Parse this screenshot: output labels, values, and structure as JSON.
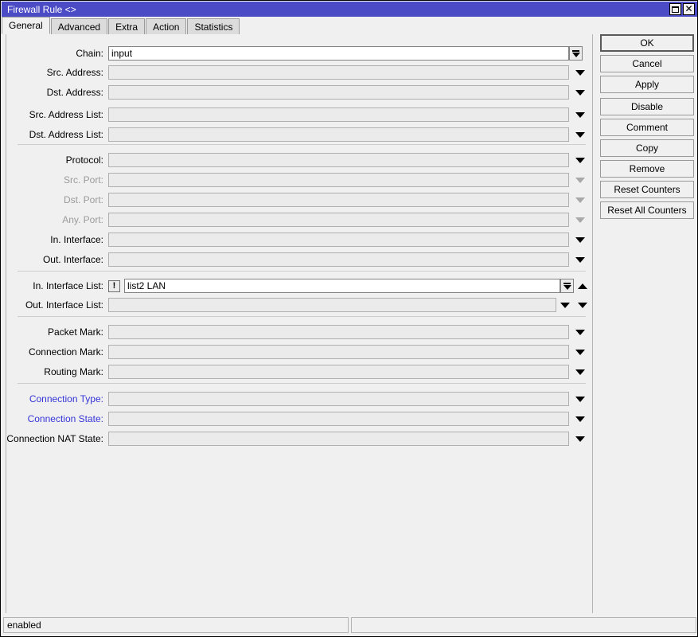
{
  "window": {
    "title": "Firewall Rule <>",
    "maximize_label": "maximize",
    "close_label": "close"
  },
  "tabs": [
    {
      "label": "General",
      "active": true
    },
    {
      "label": "Advanced",
      "active": false
    },
    {
      "label": "Extra",
      "active": false
    },
    {
      "label": "Action",
      "active": false
    },
    {
      "label": "Statistics",
      "active": false
    }
  ],
  "fields": [
    {
      "label": "Chain:",
      "value": "input",
      "state": "editable",
      "control": "combo"
    },
    {
      "label": "Src. Address:",
      "value": "",
      "state": "normal",
      "control": "arrow"
    },
    {
      "label": "Dst. Address:",
      "value": "",
      "state": "normal",
      "control": "arrow"
    },
    {
      "label": "Src. Address List:",
      "value": "",
      "state": "normal",
      "control": "arrow"
    },
    {
      "label": "Dst. Address List:",
      "value": "",
      "state": "normal",
      "control": "arrow"
    },
    {
      "label": "Protocol:",
      "value": "",
      "state": "normal",
      "control": "arrow"
    },
    {
      "label": "Src. Port:",
      "value": "",
      "state": "disabled",
      "control": "arrow"
    },
    {
      "label": "Dst. Port:",
      "value": "",
      "state": "disabled",
      "control": "arrow"
    },
    {
      "label": "Any. Port:",
      "value": "",
      "state": "disabled",
      "control": "arrow"
    },
    {
      "label": "In. Interface:",
      "value": "",
      "state": "normal",
      "control": "arrow"
    },
    {
      "label": "Out. Interface:",
      "value": "",
      "state": "normal",
      "control": "arrow"
    },
    {
      "label": "In. Interface List:",
      "value": "list2 LAN",
      "state": "editable",
      "control": "combo-negate-spin",
      "negate": "!"
    },
    {
      "label": "Out. Interface List:",
      "value": "",
      "state": "normal",
      "control": "arrow-spin-down"
    },
    {
      "label": "Packet Mark:",
      "value": "",
      "state": "normal",
      "control": "arrow"
    },
    {
      "label": "Connection Mark:",
      "value": "",
      "state": "normal",
      "control": "arrow"
    },
    {
      "label": "Routing Mark:",
      "value": "",
      "state": "normal",
      "control": "arrow"
    },
    {
      "label": "Connection Type:",
      "value": "",
      "state": "link",
      "control": "arrow"
    },
    {
      "label": "Connection State:",
      "value": "",
      "state": "link",
      "control": "arrow"
    },
    {
      "label": "Connection NAT State:",
      "value": "",
      "state": "normal",
      "control": "arrow"
    }
  ],
  "buttons": [
    {
      "label": "OK",
      "variant": "default"
    },
    {
      "label": "Cancel",
      "variant": "normal"
    },
    {
      "label": "Apply",
      "variant": "normal"
    },
    {
      "label": "Disable",
      "variant": "gap"
    },
    {
      "label": "Comment",
      "variant": "normal"
    },
    {
      "label": "Copy",
      "variant": "normal"
    },
    {
      "label": "Remove",
      "variant": "normal"
    },
    {
      "label": "Reset Counters",
      "variant": "normal"
    },
    {
      "label": "Reset All Counters",
      "variant": "normal"
    }
  ],
  "statusbar": {
    "left": "enabled",
    "right": ""
  },
  "colors": {
    "titlebar": "#4b4bc6",
    "titlebar_text": "#ffffff",
    "window_bg": "#f0f0f0",
    "field_bg": "#ebebeb",
    "field_editable_bg": "#ffffff",
    "label_disabled": "#9a9a9a",
    "label_link": "#3535d8"
  }
}
